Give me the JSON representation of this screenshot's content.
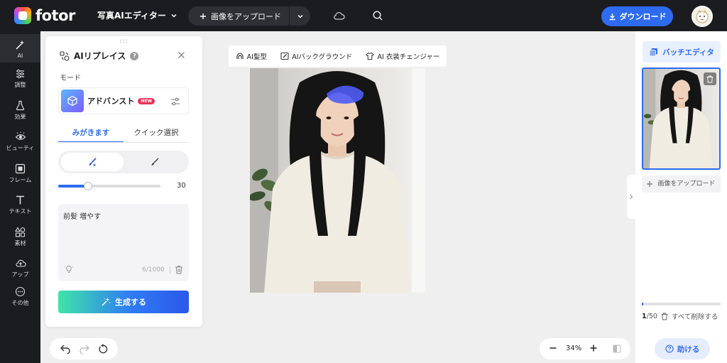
{
  "header": {
    "logo_text": "fotor",
    "editor_label": "写真AIエディター",
    "upload_label": "画像をアップロード",
    "download_label": "ダウンロード"
  },
  "rail": {
    "items": [
      {
        "label": "AI",
        "icon": "magic-wand-icon"
      },
      {
        "label": "調整",
        "icon": "sliders-icon"
      },
      {
        "label": "効果",
        "icon": "flask-icon"
      },
      {
        "label": "ビューティ",
        "icon": "eye-icon"
      },
      {
        "label": "フレーム",
        "icon": "frame-icon"
      },
      {
        "label": "テキスト",
        "icon": "text-icon"
      },
      {
        "label": "素材",
        "icon": "shapes-icon"
      },
      {
        "label": "アップ",
        "icon": "cloud-upload-icon"
      },
      {
        "label": "その他",
        "icon": "more-icon"
      }
    ]
  },
  "panel": {
    "title": "AIリプレイス",
    "mode_label": "モード",
    "mode_name": "アドバンスト",
    "new_badge": "NEW",
    "tab_brush": "みがきます",
    "tab_quick": "クイック選択",
    "brush_size": "30",
    "brush_size_fraction": 0.29,
    "prompt_text": "前髪 増やす",
    "prompt_count": "6/1000",
    "generate_label": "生成する"
  },
  "canvas_tools": {
    "hair": "AI髪型",
    "background": "AIバックグラウンド",
    "outfit": "AI 衣装チェンジャー"
  },
  "zoom": {
    "value": "34%"
  },
  "right_panel": {
    "batch_label": "バッチエディタ",
    "add_image_label": "画像をアップロード",
    "count_current": "1",
    "count_total": "/50",
    "progress_fraction": 0.02,
    "delete_all_label": "すべて削除する",
    "help_label": "助ける"
  },
  "colors": {
    "accent": "#2e6bf0",
    "topbar": "#1b1c20",
    "mask": "#4f5bf5"
  }
}
